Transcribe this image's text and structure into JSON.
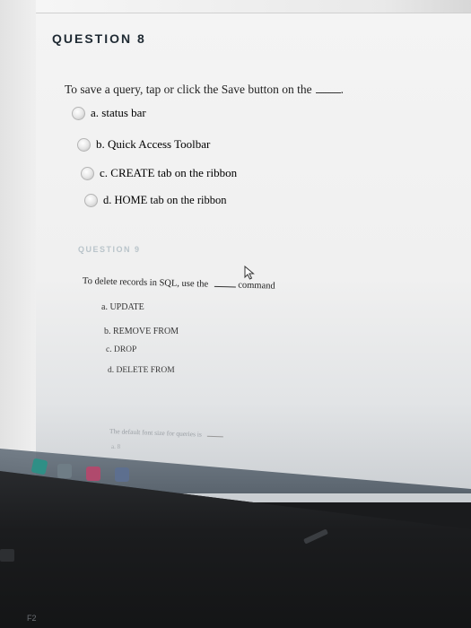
{
  "q8": {
    "heading": "QUESTION 8",
    "prompt": "To save a query, tap or click the Save button on the",
    "options": [
      "a. status bar",
      "b. Quick Access Toolbar",
      "c. CREATE tab on the ribbon",
      "d. HOME tab on the ribbon"
    ]
  },
  "q9": {
    "heading": "QUESTION 9",
    "prompt_start": "To delete records in SQL, use the",
    "prompt_end": "command",
    "options": [
      "a. UPDATE",
      "b. REMOVE FROM",
      "c. DROP",
      "d. DELETE FROM"
    ]
  },
  "q10": {
    "prompt": "The default font size for queries is",
    "option_first": "a. 8"
  },
  "keyboard": {
    "f2": "F2"
  },
  "colors": {
    "heading": "#1f2a33",
    "faded_heading": "#b9c4ca",
    "text": "#222222"
  }
}
